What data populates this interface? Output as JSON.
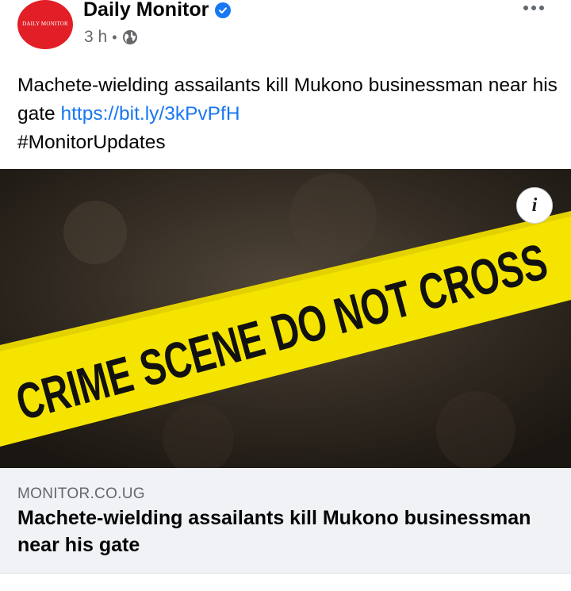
{
  "post": {
    "page_name": "Daily Monitor",
    "avatar_text": "DAILY MONITOR",
    "time": "3 h",
    "separator": "•",
    "text_main": "Machete-wielding assailants kill Mukono businessman near his gate",
    "link_text": "https://bit.ly/3kPvPfH",
    "hashtag": "#MonitorUpdates"
  },
  "image": {
    "tape_text": "CRIME SCENE DO NOT CROSS",
    "info_label": "i",
    "tape_color": "#f5e400"
  },
  "link_preview": {
    "domain": "MONITOR.CO.UG",
    "title": "Machete-wielding assailants kill Mukono businessman near his gate"
  },
  "icons": {
    "verified": "verified-badge-icon",
    "audience": "globe-icon",
    "more": "more-options-icon"
  },
  "colors": {
    "accent": "#1877f2",
    "brand_red": "#e21f26",
    "secondary_text": "#65676b"
  }
}
